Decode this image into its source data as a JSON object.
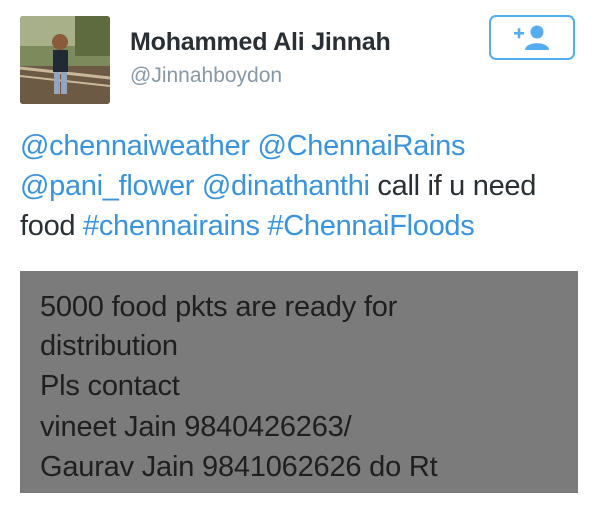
{
  "author": {
    "display_name": "Mohammed Ali Jinnah",
    "handle": "@Jinnahboydon",
    "avatar_icon": "profile-photo"
  },
  "follow_button": {
    "icon": "add-user-icon",
    "accent": "#55acee"
  },
  "tweet": {
    "line1": {
      "mention1": "@chennaiweather",
      "sep1": " ",
      "mention2": "@ChennaiRains"
    },
    "line2": {
      "mention3": "@pani_flower",
      "sep2": " ",
      "mention4": "@dinathanthi",
      "text1": " call if u need"
    },
    "line3": {
      "text2": "food ",
      "hashtag1": "#chennairains",
      "sep3": " ",
      "hashtag2": "#ChennaiFloods"
    },
    "link_color": "#3b94d9"
  },
  "media": {
    "lines": [
      "5000 food pkts are ready for",
      "distribution",
      "Pls contact",
      "vineet Jain 9840426263/",
      "Gaurav Jain 9841062626 do Rt"
    ],
    "background": "#7b7b7b"
  }
}
